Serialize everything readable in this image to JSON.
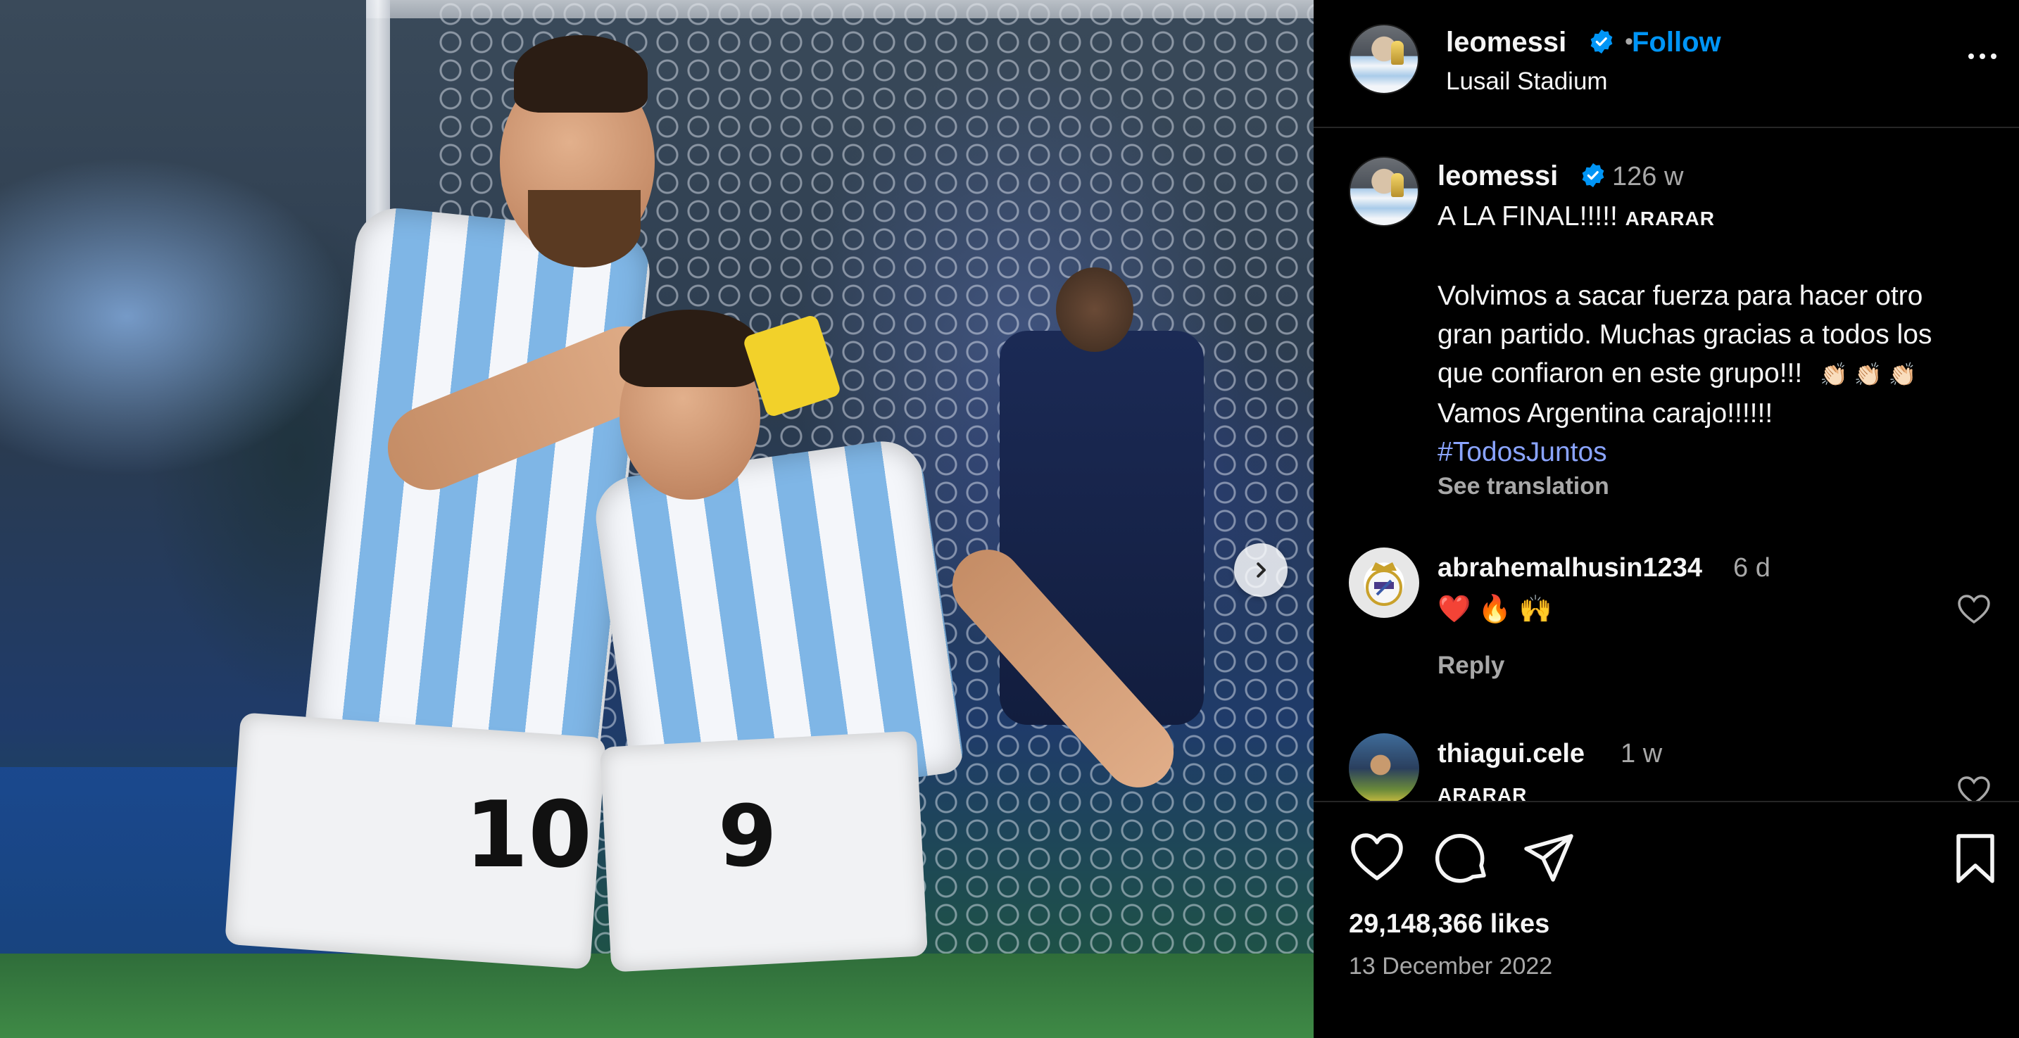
{
  "post": {
    "author": "leomessi",
    "follow_label": "Follow",
    "separator": "•",
    "location": "Lusail Stadium",
    "more_label": "More options",
    "next_label": "Next"
  },
  "caption": {
    "author": "leomessi",
    "time": "126 w",
    "line1": "A LA FINAL!!!!!",
    "line1_tag": "ARARAR",
    "body_line1": "Volvimos a sacar fuerza para hacer otro",
    "body_line2": "gran partido. Muchas gracias a todos los",
    "body_line3": "que confiaron en este grupo!!!",
    "body_emojis": "👏🏻 👏🏻 👏🏻",
    "body_line4": "Vamos Argentina carajo!!!!!!",
    "hashtag": "#TodosJuntos",
    "see_translation": "See translation"
  },
  "comments": [
    {
      "username": "abrahemalhusin1234",
      "time": "6 d",
      "text": "❤️ 🔥 🙌",
      "reply_label": "Reply"
    },
    {
      "username": "thiagui.cele",
      "time": "1 w",
      "text": "ARARAR"
    }
  ],
  "footer": {
    "likes": "29,148,366 likes",
    "date": "13 December 2022"
  },
  "icons": {
    "like": "heart-icon",
    "comment": "comment-bubble-icon",
    "share": "paper-plane-icon",
    "save": "bookmark-icon",
    "verified": "verified-badge-icon",
    "next": "chevron-right-icon"
  },
  "colors": {
    "background": "#000000",
    "accent": "#0095f6",
    "hashtag": "#8aa4ff",
    "muted": "#a8a8a8",
    "heart_red": "#ff3040"
  }
}
